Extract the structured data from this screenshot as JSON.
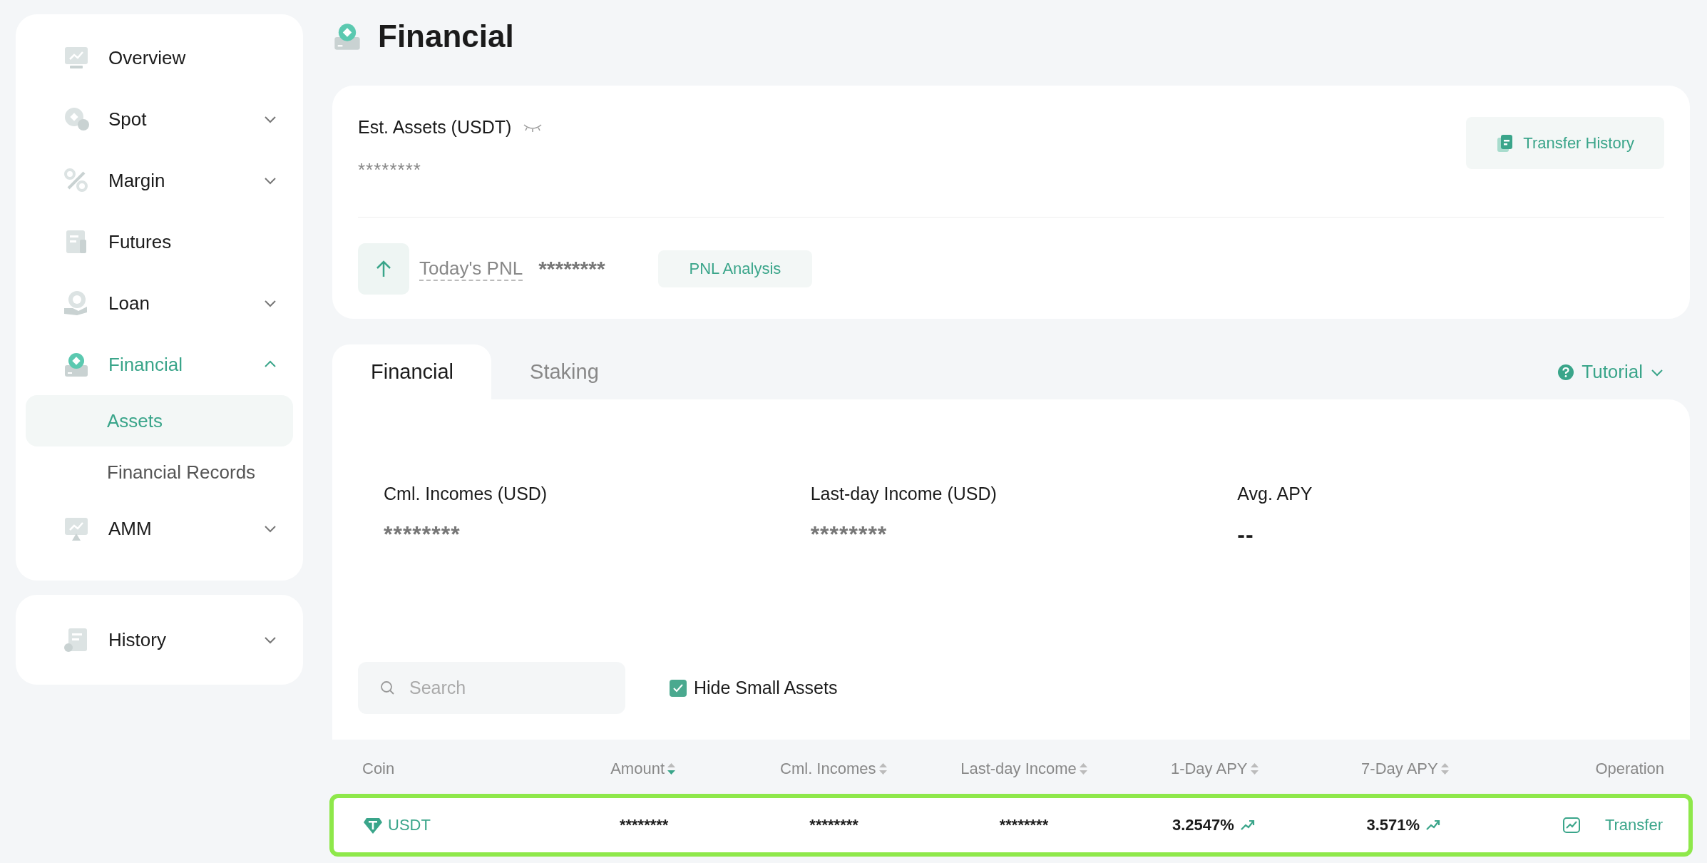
{
  "sidebar": {
    "groups": [
      {
        "items": [
          {
            "label": "Overview",
            "expandable": false,
            "selected": false
          },
          {
            "label": "Spot",
            "expandable": true,
            "expanded": false,
            "selected": false
          },
          {
            "label": "Margin",
            "expandable": true,
            "expanded": false,
            "selected": false
          },
          {
            "label": "Futures",
            "expandable": false,
            "selected": false
          },
          {
            "label": "Loan",
            "expandable": true,
            "expanded": false,
            "selected": false
          },
          {
            "label": "Financial",
            "expandable": true,
            "expanded": true,
            "selected": true,
            "children": [
              {
                "label": "Assets",
                "selected": true
              },
              {
                "label": "Financial Records",
                "selected": false
              }
            ]
          },
          {
            "label": "AMM",
            "expandable": true,
            "expanded": false,
            "selected": false
          }
        ]
      },
      {
        "items": [
          {
            "label": "History",
            "expandable": true,
            "expanded": false,
            "selected": false
          }
        ]
      }
    ]
  },
  "page_title": "Financial",
  "summary": {
    "est_assets_label": "Est. Assets (USDT)",
    "est_assets_value": "********",
    "transfer_history_button": "Transfer History",
    "pnl_label": "Today's PNL",
    "pnl_value": "********",
    "pnl_analysis_button": "PNL Analysis"
  },
  "tabs": [
    {
      "label": "Financial",
      "selected": true
    },
    {
      "label": "Staking",
      "selected": false
    }
  ],
  "tutorial": "Tutorial",
  "stats": [
    {
      "label": "Cml. Incomes (USD)",
      "value": "********"
    },
    {
      "label": "Last-day Income (USD)",
      "value": "********"
    },
    {
      "label": "Avg. APY",
      "value": "--"
    }
  ],
  "search": {
    "placeholder": "Search"
  },
  "hide_small_assets": {
    "label": "Hide Small Assets",
    "checked": true
  },
  "table": {
    "columns": [
      {
        "label": "Coin"
      },
      {
        "label": "Amount",
        "sortable": true,
        "sorted": true
      },
      {
        "label": "Cml. Incomes",
        "sortable": true,
        "sorted": false
      },
      {
        "label": "Last-day Income",
        "sortable": true,
        "sorted": false
      },
      {
        "label": "1-Day APY",
        "sortable": true,
        "sorted": false
      },
      {
        "label": "7-Day APY",
        "sortable": true,
        "sorted": false
      },
      {
        "label": "Operation"
      }
    ],
    "rows": [
      {
        "coin": "USDT",
        "amount": "********",
        "cml_incomes": "********",
        "last_day_income": "********",
        "apy_1d": "3.2547%",
        "apy_7d": "3.571%",
        "operation": "Transfer",
        "highlighted": true
      }
    ]
  }
}
